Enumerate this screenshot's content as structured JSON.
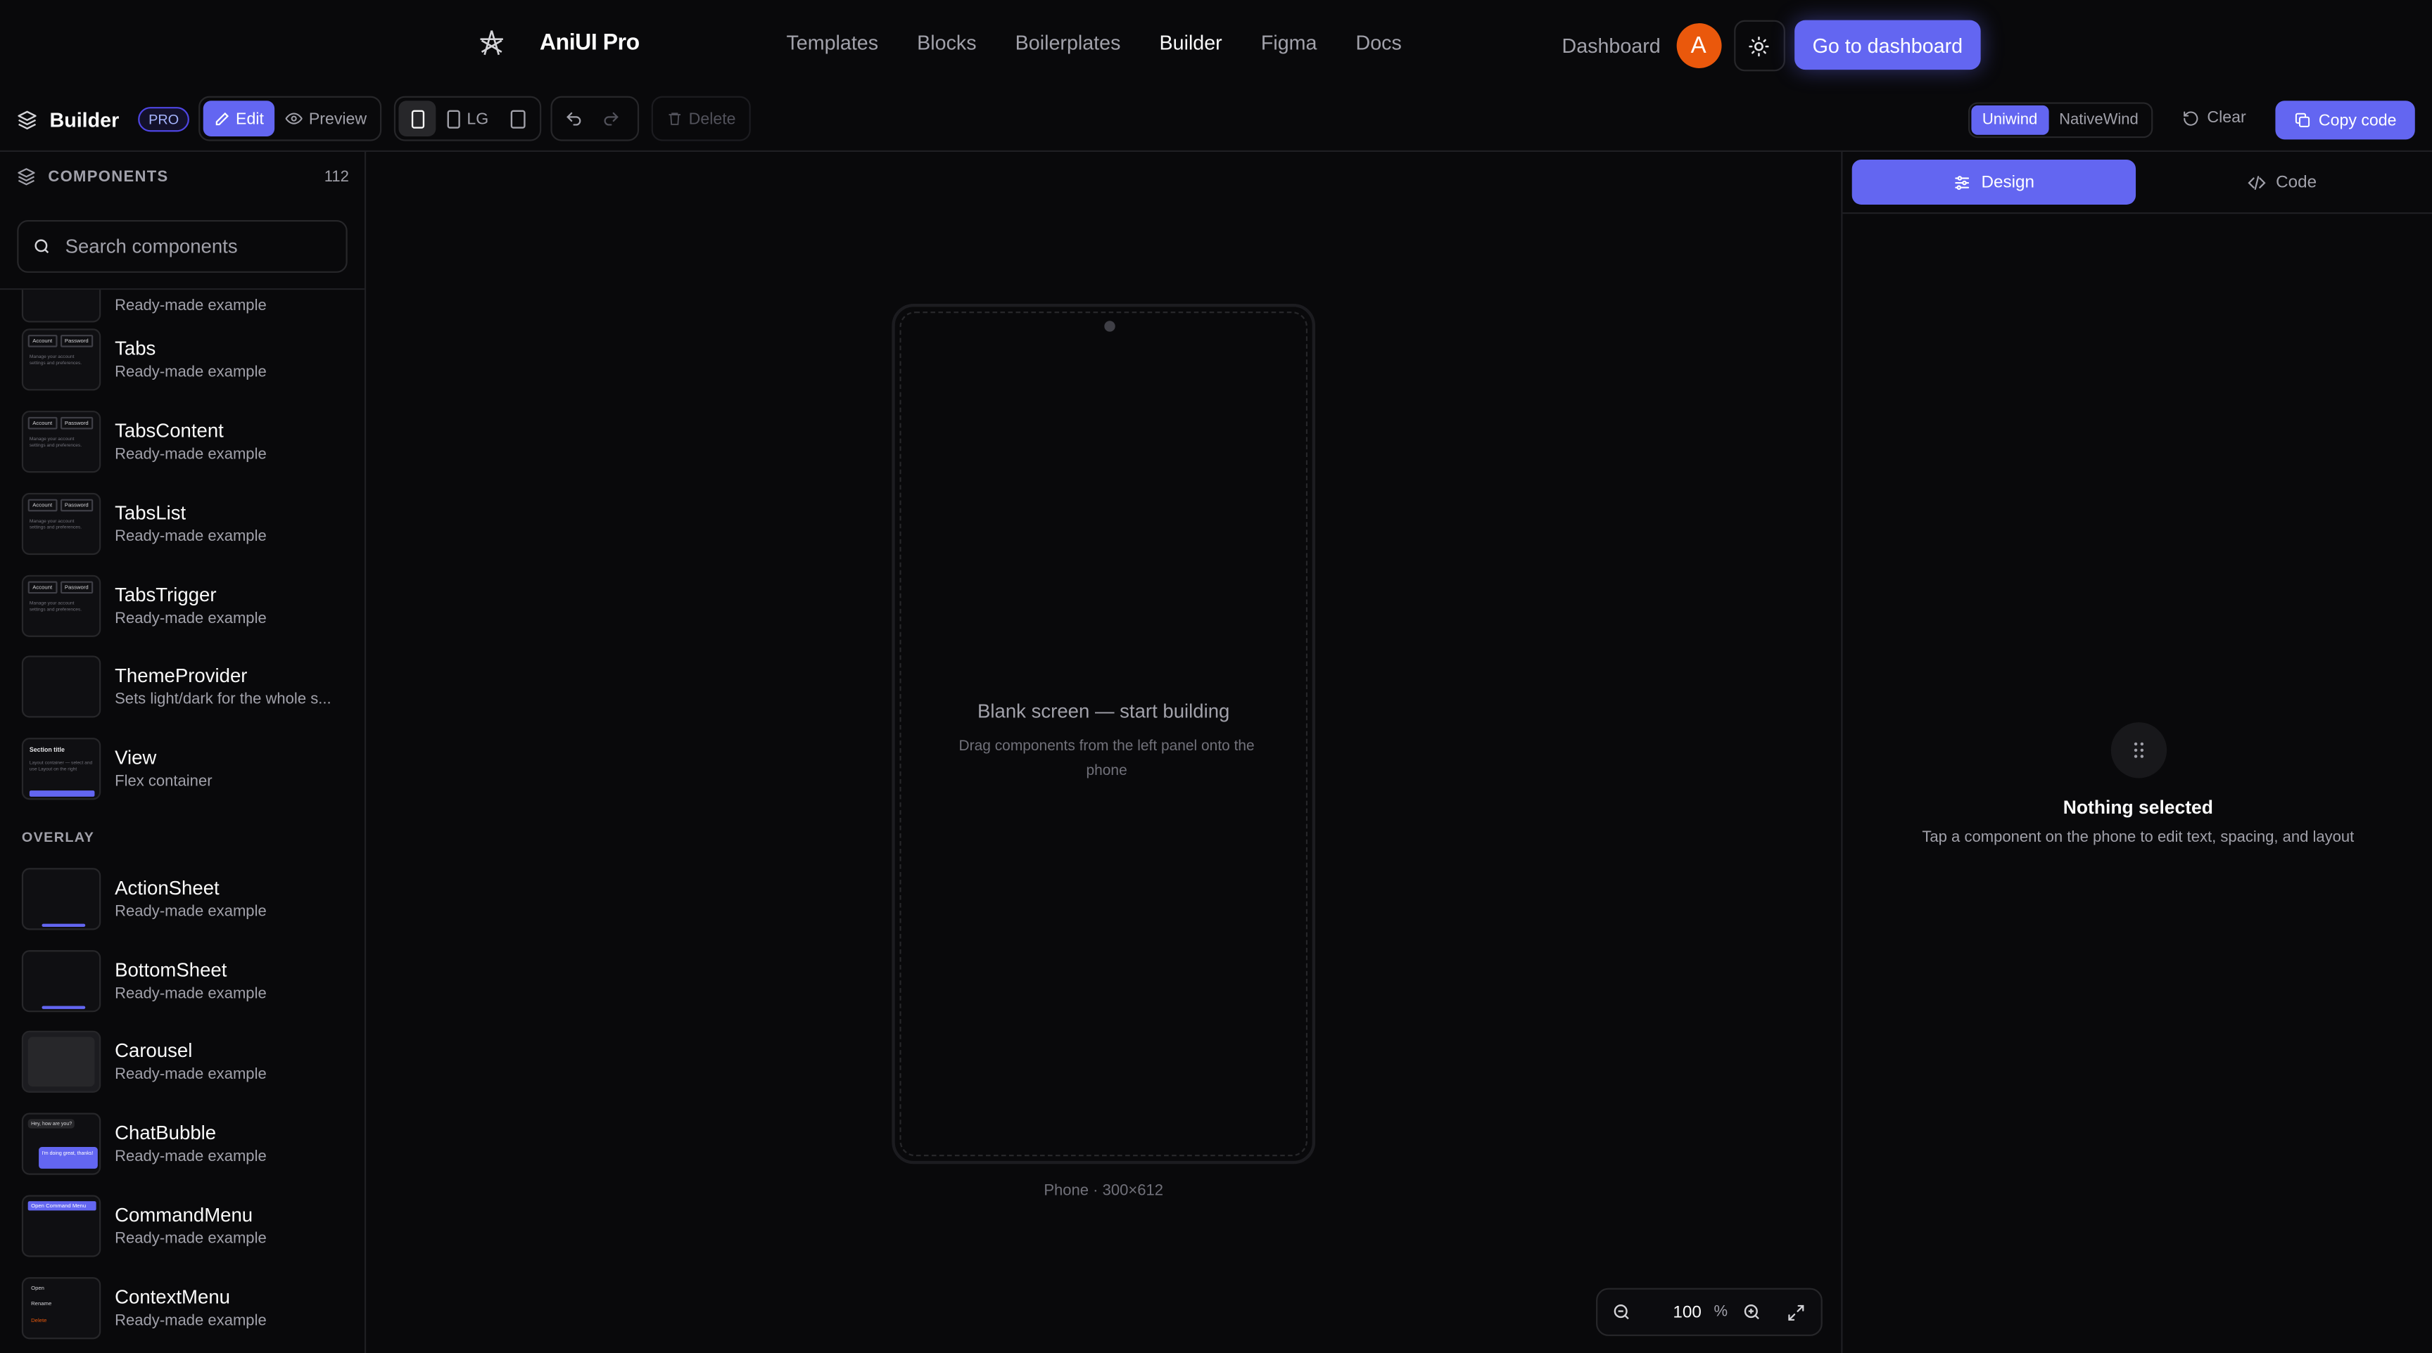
{
  "topnav": {
    "brand": "AniUI Pro",
    "links": [
      "Templates",
      "Blocks",
      "Boilerplates",
      "Builder",
      "Figma",
      "Docs"
    ],
    "active_link": "Builder",
    "dashboard": "Dashboard",
    "avatar_initial": "A",
    "cta": "Go to dashboard"
  },
  "toolbar": {
    "title": "Builder",
    "badge": "PRO",
    "edit": "Edit",
    "preview": "Preview",
    "device_lg": "LG",
    "delete": "Delete",
    "uniwind": "Uniwind",
    "nativewind": "NativeWind",
    "clear": "Clear",
    "copy_code": "Copy code"
  },
  "components_panel": {
    "heading": "COMPONENTS",
    "count": "112",
    "search_placeholder": "Search components",
    "partial_item_desc": "Ready-made example",
    "items": [
      {
        "name": "Tabs",
        "desc": "Ready-made example",
        "thumb": "tabs"
      },
      {
        "name": "TabsContent",
        "desc": "Ready-made example",
        "thumb": "tabs"
      },
      {
        "name": "TabsList",
        "desc": "Ready-made example",
        "thumb": "tabs"
      },
      {
        "name": "TabsTrigger",
        "desc": "Ready-made example",
        "thumb": "tabs"
      },
      {
        "name": "ThemeProvider",
        "desc": "Sets light/dark for the whole s...",
        "thumb": "blank"
      },
      {
        "name": "View",
        "desc": "Flex container",
        "thumb": "view"
      }
    ],
    "section_overlay": "OVERLAY",
    "overlay_items": [
      {
        "name": "ActionSheet",
        "desc": "Ready-made example",
        "thumb": "sheet"
      },
      {
        "name": "BottomSheet",
        "desc": "Ready-made example",
        "thumb": "sheet"
      },
      {
        "name": "Carousel",
        "desc": "Ready-made example",
        "thumb": "carousel"
      },
      {
        "name": "ChatBubble",
        "desc": "Ready-made example",
        "thumb": "chat"
      },
      {
        "name": "CommandMenu",
        "desc": "Ready-made example",
        "thumb": "command"
      },
      {
        "name": "ContextMenu",
        "desc": "Ready-made example",
        "thumb": "context"
      }
    ],
    "thumb_text": {
      "tab_account": "Account",
      "tab_password": "Password",
      "tab_body": "Manage your account settings and preferences.",
      "view_title": "Section title",
      "view_body": "Layout container — select and use Layout on the right",
      "chat_in": "Hey, how are you?",
      "chat_out": "I'm doing great, thanks!",
      "command_btn": "Open Command Menu",
      "ctx_open": "Open",
      "ctx_rename": "Rename",
      "ctx_delete": "Delete"
    }
  },
  "canvas": {
    "blank_title": "Blank screen — start building",
    "blank_desc": "Drag components from the left panel onto the phone",
    "phone_label": "Phone · 300×612",
    "zoom_value": "100",
    "zoom_unit": "%"
  },
  "inspector": {
    "tab_design": "Design",
    "tab_code": "Code",
    "empty_title": "Nothing selected",
    "empty_desc": "Tap a component on the phone to edit text, spacing, and layout"
  },
  "colors": {
    "accent": "#6366f1",
    "background": "#09090b",
    "avatar": "#ea580c"
  }
}
